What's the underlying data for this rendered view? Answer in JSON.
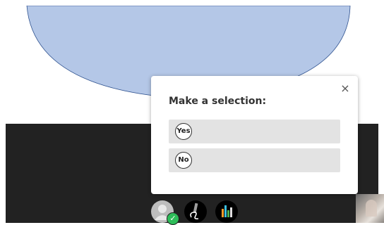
{
  "modal": {
    "title": "Make a selection:",
    "close_glyph": "×",
    "options": [
      {
        "label": "Yes"
      },
      {
        "label": "No"
      }
    ]
  },
  "toolbar": {
    "icons": [
      "user-avatar-icon",
      "checkmark-icon",
      "pencil-icon",
      "bar-chart-icon"
    ]
  },
  "colors": {
    "slide_shape_fill": "#b4c7e7",
    "slide_shape_stroke": "#2f528f",
    "stage_background": "#222222",
    "option_background": "#e3e3e3",
    "check_badge": "#2ebd59"
  }
}
